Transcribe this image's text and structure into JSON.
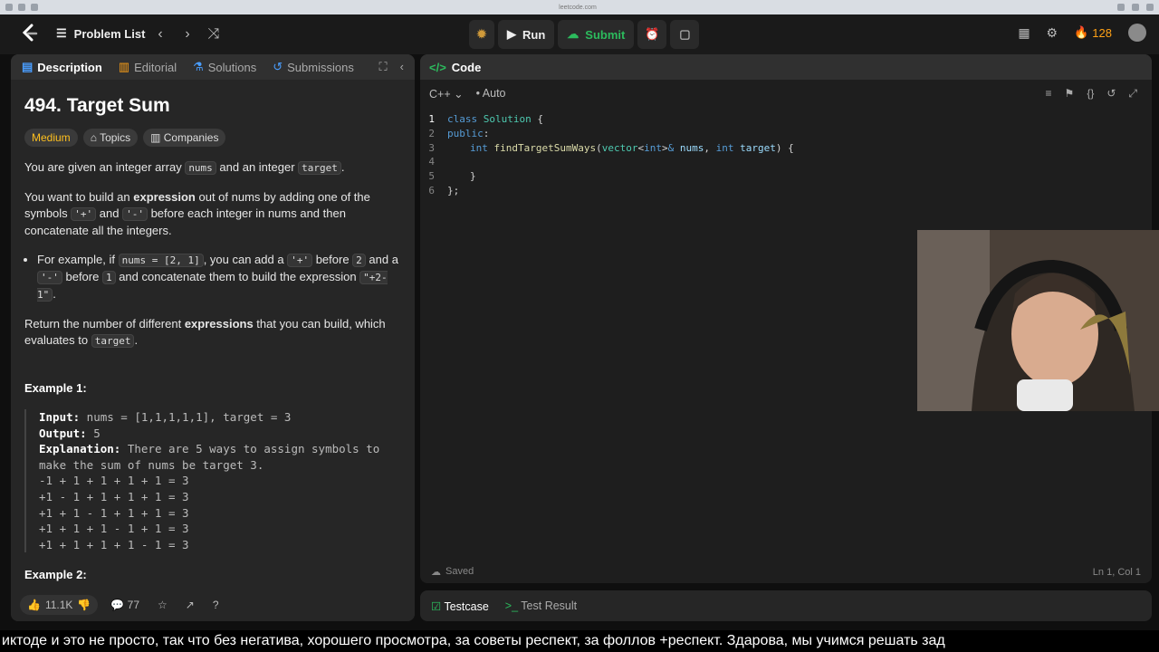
{
  "browser": {
    "url": "leetcode.com"
  },
  "topbar": {
    "problem_list_label": "Problem List",
    "run_label": "Run",
    "submit_label": "Submit",
    "streak_count": "128"
  },
  "left_tabs": [
    {
      "label": "Description"
    },
    {
      "label": "Editorial"
    },
    {
      "label": "Solutions"
    },
    {
      "label": "Submissions"
    }
  ],
  "problem": {
    "title": "494. Target Sum",
    "difficulty": "Medium",
    "topics_label": "Topics",
    "companies_label": "Companies",
    "p1_a": "You are given an integer array ",
    "p1_code1": "nums",
    "p1_b": " and an integer ",
    "p1_code2": "target",
    "p1_c": ".",
    "p2_a": "You want to build an ",
    "p2_bold": "expression",
    "p2_b": " out of nums by adding one of the symbols ",
    "p2_code1": "'+'",
    "p2_c": " and ",
    "p2_code2": "'-'",
    "p2_d": " before each integer in nums and then concatenate all the integers.",
    "li_a": "For example, if ",
    "li_code1": "nums = [2, 1]",
    "li_b": ", you can add a ",
    "li_code2": "'+'",
    "li_c": " before ",
    "li_code3": "2",
    "li_d": " and a ",
    "li_code4": "'-'",
    "li_e": " before ",
    "li_code5": "1",
    "li_f": " and concatenate them to build the expression ",
    "li_code6": "\"+2-1\"",
    "li_g": ".",
    "p3_a": "Return the number of different ",
    "p3_bold": "expressions",
    "p3_b": " that you can build, which evaluates to ",
    "p3_code": "target",
    "p3_c": ".",
    "example1_heading": "Example 1:",
    "ex1_input_label": "Input:",
    "ex1_input": " nums = [1,1,1,1,1], target = 3",
    "ex1_output_label": "Output:",
    "ex1_output": " 5",
    "ex1_expl_label": "Explanation:",
    "ex1_expl": " There are 5 ways to assign symbols to make the sum of nums be target 3.",
    "ex1_lines": [
      "-1 + 1 + 1 + 1 + 1 = 3",
      "+1 - 1 + 1 + 1 + 1 = 3",
      "+1 + 1 - 1 + 1 + 1 = 3",
      "+1 + 1 + 1 - 1 + 1 = 3",
      "+1 + 1 + 1 + 1 - 1 = 3"
    ],
    "example2_heading": "Example 2:"
  },
  "bottombar": {
    "likes": "11.1K",
    "comments": "77"
  },
  "code_panel": {
    "title": "Code",
    "language": "C++",
    "mode": "Auto",
    "saved_label": "Saved",
    "cursor_pos": "Ln 1, Col 1",
    "lines": [
      "1",
      "2",
      "3",
      "4",
      "5",
      "6"
    ]
  },
  "test_panel": {
    "testcase_label": "Testcase",
    "result_label": "Test Result"
  },
  "subtitle": "иктоде и это не просто, так что без негатива, хорошего просмотра, за советы респект, за фоллов +респект. Здарова, мы учимся решать зад"
}
